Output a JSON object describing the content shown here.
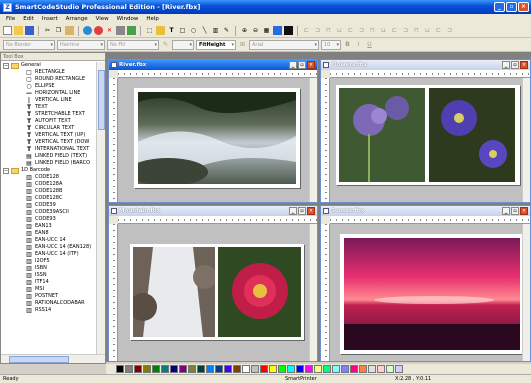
{
  "window": {
    "title": "SmartCodeStudio Professional Edition - [River.fbx]"
  },
  "menu": [
    "File",
    "Edit",
    "Insert",
    "Arrange",
    "View",
    "Window",
    "Help"
  ],
  "toolbar2": {
    "border": "No Border",
    "hairline": "Hairline",
    "fill": "No Fill",
    "zoom": "FitHeight",
    "font": "Arial",
    "size": "10"
  },
  "toolbox": {
    "title": "Tool Box"
  },
  "tree": {
    "general_label": "General",
    "general_items": [
      {
        "icon": "□",
        "label": "RECTANGLE",
        "name": "rectangle-icon"
      },
      {
        "icon": "▢",
        "label": "ROUND RECTANGLE",
        "name": "round-rectangle-icon"
      },
      {
        "icon": "○",
        "label": "ELLIPSE",
        "name": "ellipse-icon"
      },
      {
        "icon": "—",
        "label": "HORIZONTAL LINE",
        "name": "horizontal-line-icon"
      },
      {
        "icon": "|",
        "label": "VERTICAL LINE",
        "name": "vertical-line-icon"
      },
      {
        "icon": "T",
        "label": "TEXT",
        "name": "text-icon"
      },
      {
        "icon": "T",
        "label": "STRETCHABLE TEXT",
        "name": "text-icon"
      },
      {
        "icon": "T",
        "label": "AUTOFIT TEXT",
        "name": "text-icon"
      },
      {
        "icon": "T",
        "label": "CIRCULAR TEXT",
        "name": "text-icon"
      },
      {
        "icon": "T",
        "label": "VERTICAL TEXT (UP)",
        "name": "text-icon"
      },
      {
        "icon": "T",
        "label": "VERTICAL TEXT (DOW",
        "name": "text-icon"
      },
      {
        "icon": "T",
        "label": "INTERNATIONAL TEXT",
        "name": "text-icon"
      },
      {
        "icon": "▤",
        "label": "LINKED FIELD (TEXT)",
        "name": "linked-field-icon"
      },
      {
        "icon": "▤",
        "label": "LINKED FIELD (BARCO",
        "name": "linked-field-icon"
      }
    ],
    "barcode_label": "1D Barcode",
    "barcode_items": [
      "CODE128",
      "CODE128A",
      "CODE128B",
      "CODE128C",
      "CODE39",
      "CODE39ASCII",
      "CODE93",
      "EAN13",
      "EAN8",
      "EAN-UCC 14",
      "EAN-UCC 14 (EAN128)",
      "EAN-UCC 14 (ITF)",
      "I2OF5",
      "ISBN",
      "ISSN",
      "ITF14",
      "MSI",
      "POSTNET",
      "RATIONALCODABAR",
      "RSS14"
    ]
  },
  "docs": [
    {
      "title": "River.fbx"
    },
    {
      "title": "Flowers.fbx"
    },
    {
      "title": "Mountain.fbx"
    },
    {
      "title": "Sunset.fbx"
    }
  ],
  "palette": [
    "#000000",
    "#7f7f7f",
    "#7f0000",
    "#7f7f00",
    "#007f00",
    "#007f7f",
    "#00007f",
    "#7f007f",
    "#7f7f3f",
    "#003f3f",
    "#007fff",
    "#003f7f",
    "#3f00ff",
    "#7f3f00",
    "#ffffff",
    "#c0c0c0",
    "#ff0000",
    "#ffff00",
    "#00ff00",
    "#00ffff",
    "#0000ff",
    "#ff00ff",
    "#ffff7f",
    "#00ff7f",
    "#7fffff",
    "#7f7fff",
    "#ff007f",
    "#ff7f3f",
    "#e0e0e0",
    "#ffd0d0",
    "#d0ffd0",
    "#d0d0ff"
  ],
  "status": {
    "left": "Ready",
    "center": "SmartPrinter",
    "coords": "X:2.28 , Y:0.11"
  }
}
